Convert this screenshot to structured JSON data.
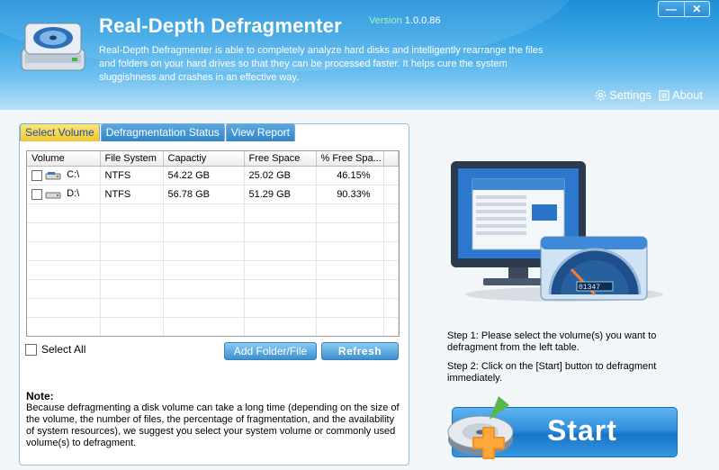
{
  "app": {
    "title": "Real-Depth Defragmenter",
    "version_label": "Version",
    "version": "1.0.0.86",
    "description": "Real-Depth Defragmenter is able to completely analyze hard disks and intelligently rearrange the files and folders on your hard drives so that they can be processed faster. It helps cure the system sluggishness and crashes in an effective way."
  },
  "window": {
    "minimize": "—",
    "close": "✕"
  },
  "header_links": {
    "settings": "Settings",
    "about": "About"
  },
  "tabs": [
    {
      "label": "Select Volume",
      "active": true
    },
    {
      "label": "Defragmentation Status",
      "active": false
    },
    {
      "label": "View Report",
      "active": false
    }
  ],
  "table": {
    "columns": [
      "Volume",
      "File System",
      "Capactiy",
      "Free Space",
      "% Free Spa..."
    ],
    "rows": [
      {
        "volume": "C:\\",
        "fs": "NTFS",
        "capacity": "54.22 GB",
        "free": "25.02 GB",
        "pct": "46.15%"
      },
      {
        "volume": "D:\\",
        "fs": "NTFS",
        "capacity": "56.78 GB",
        "free": "51.29 GB",
        "pct": "90.33%"
      }
    ]
  },
  "select_all_label": "Select All",
  "buttons": {
    "add": "Add Folder/File",
    "refresh": "Refresh",
    "start": "Start"
  },
  "note": {
    "title": "Note:",
    "text": "Because defragmenting a disk volume can take a long time (depending on the size of the volume, the number of files, the percentage of fragmentation, and the availability of system resources), we suggest you select your system volume or commonly used volume(s) to defragment."
  },
  "steps": {
    "step1": "Step 1: Please select the volume(s) you want to defragment from the left table.",
    "step2": "Step 2: Click on the [Start] button to defragment immediately."
  },
  "preview_gauge": {
    "odometer": "01347"
  },
  "colors": {
    "header_blue": "#2f9ae0",
    "tab_active": "#f5d24a",
    "button_blue": "#3b90d0"
  }
}
